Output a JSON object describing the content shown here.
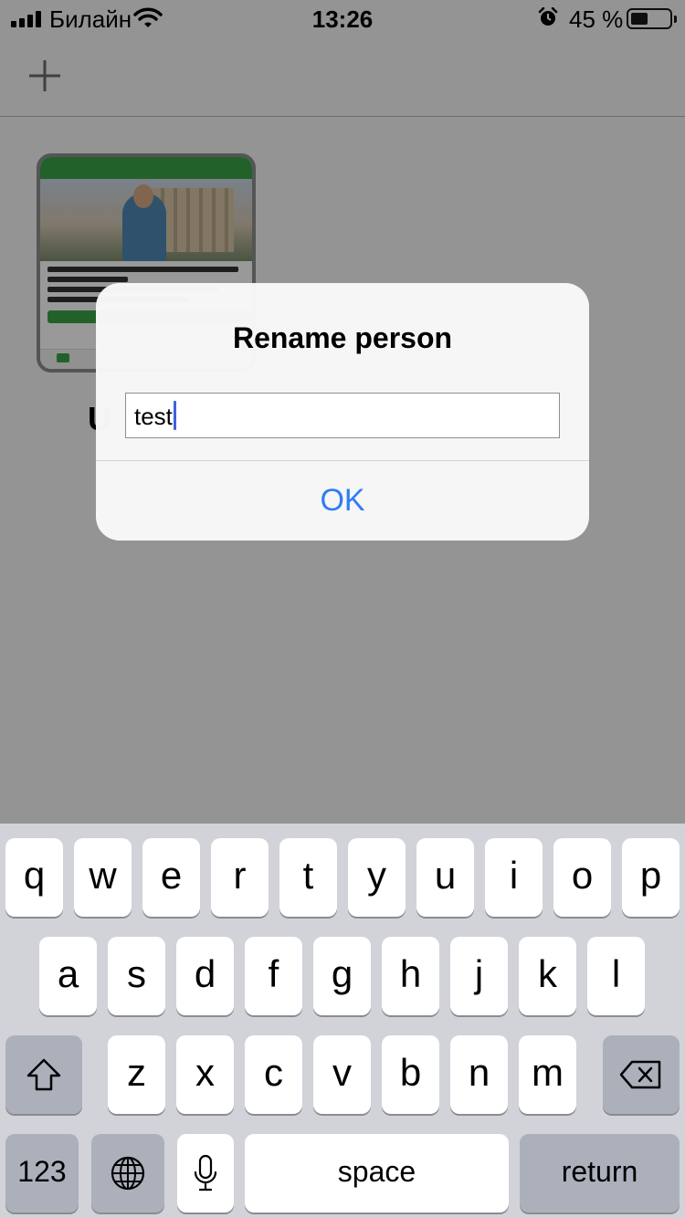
{
  "status_bar": {
    "carrier": "Билайн",
    "time": "13:26",
    "battery_percent": "45 %",
    "battery_level": 0.45,
    "icons": [
      "signal-icon",
      "wifi-icon",
      "alarm-icon",
      "battery-icon"
    ]
  },
  "nav": {
    "add_icon": "plus-icon"
  },
  "person": {
    "name_initial": "U"
  },
  "alert": {
    "title": "Rename person",
    "input_value": "test",
    "ok_label": "OK"
  },
  "keyboard": {
    "row1": [
      "q",
      "w",
      "e",
      "r",
      "t",
      "y",
      "u",
      "i",
      "o",
      "p"
    ],
    "row2": [
      "a",
      "s",
      "d",
      "f",
      "g",
      "h",
      "j",
      "k",
      "l"
    ],
    "row3": [
      "z",
      "x",
      "c",
      "v",
      "b",
      "n",
      "m"
    ],
    "shift_icon": "shift-icon",
    "delete_icon": "delete-icon",
    "numbers_label": "123",
    "globe_icon": "globe-icon",
    "mic_icon": "microphone-icon",
    "space_label": "space",
    "return_label": "return"
  },
  "colors": {
    "accent": "#2f7cf6",
    "keyboard_bg": "#d1d3d9",
    "thumbnail_green": "#3aa347"
  }
}
